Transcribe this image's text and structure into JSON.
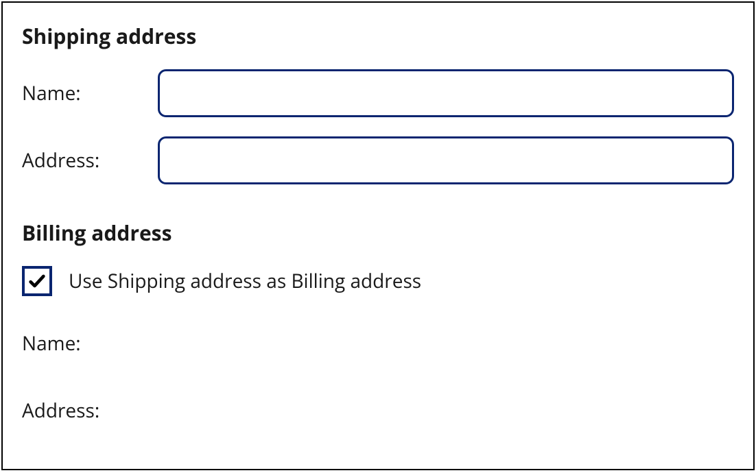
{
  "shipping": {
    "heading": "Shipping address",
    "name_label": "Name:",
    "name_value": "",
    "address_label": "Address:",
    "address_value": ""
  },
  "billing": {
    "heading": "Billing address",
    "checkbox_checked": true,
    "checkbox_label": "Use Shipping address as Billing address",
    "name_label": "Name:",
    "address_label": "Address:"
  }
}
